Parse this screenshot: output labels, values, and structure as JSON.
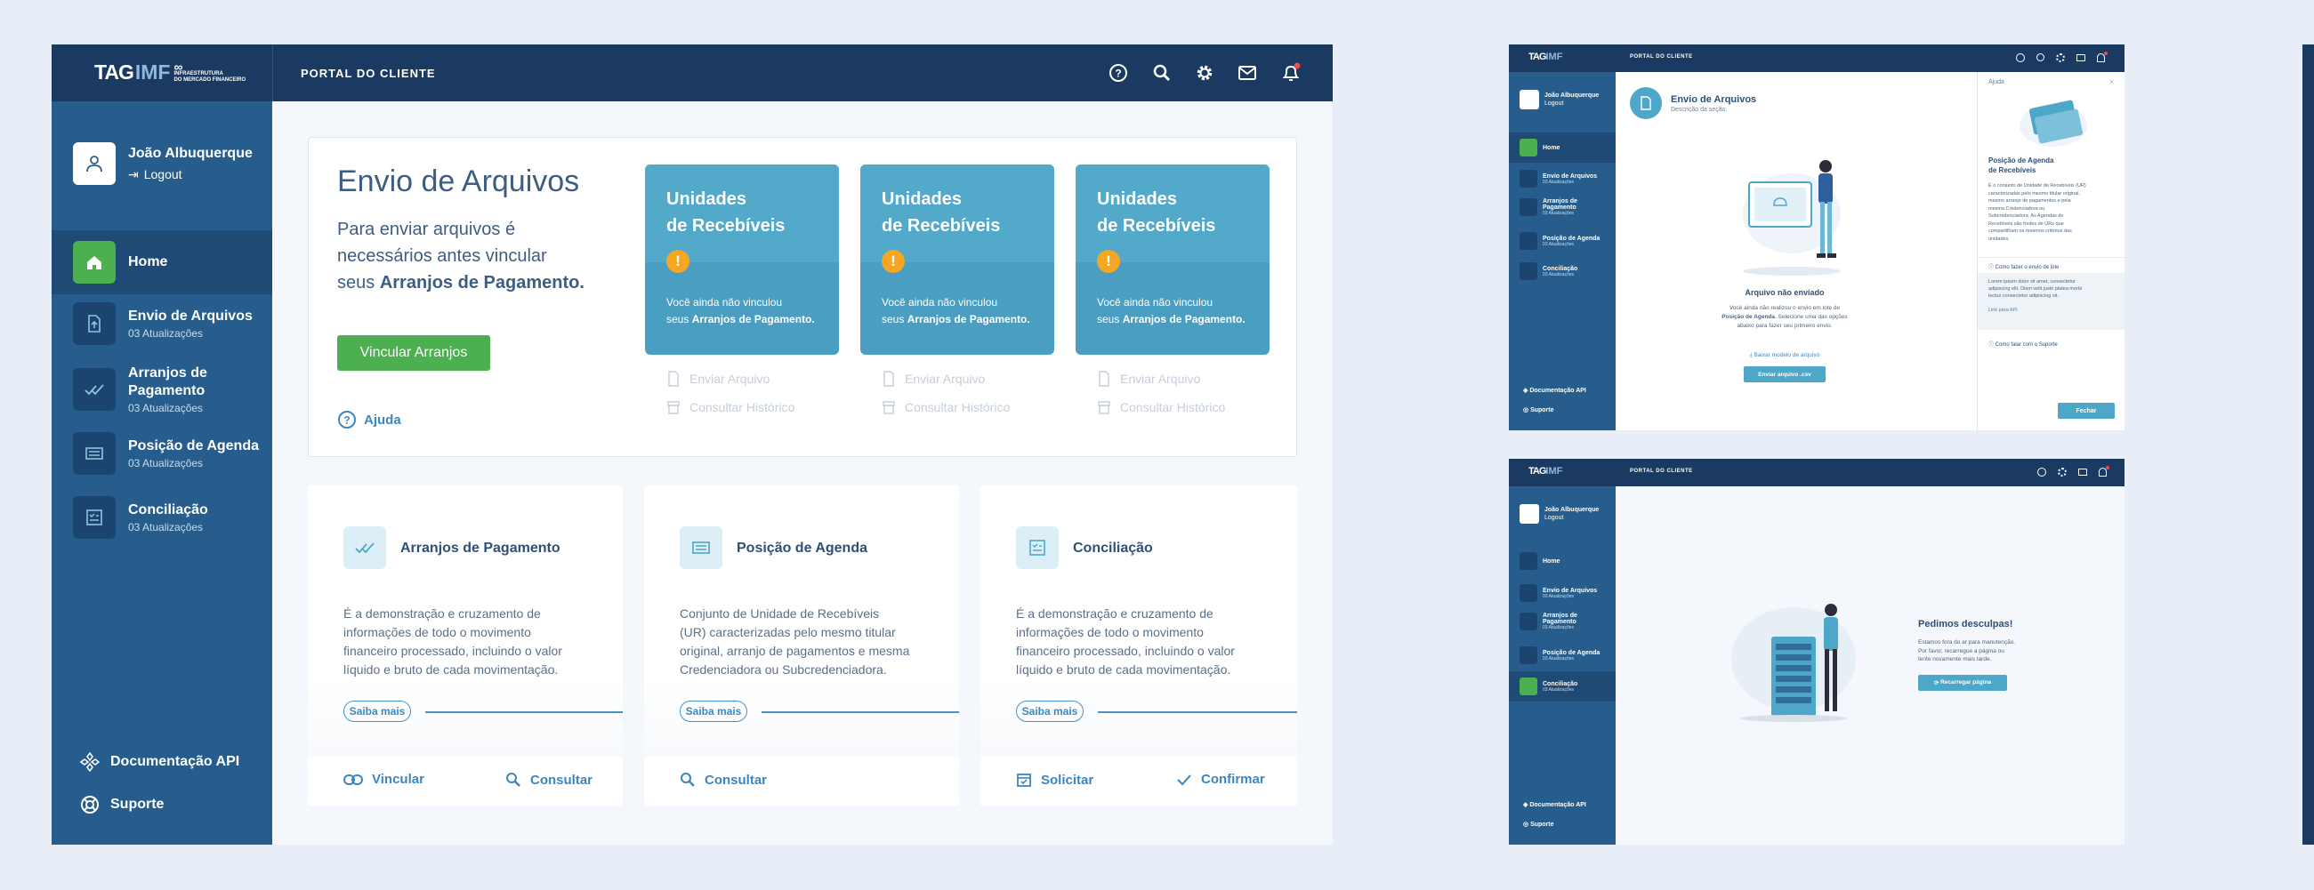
{
  "topbar": {
    "logo_tag": "TAG",
    "logo_imf": "IMF",
    "logo_sub1": "INFRAESTRUTURA",
    "logo_sub2": "DO MERCADO FINANCEIRO",
    "portal_title": "PORTAL DO CLIENTE"
  },
  "user": {
    "name": "João Albuquerque",
    "logout": "Logout"
  },
  "sidebar": {
    "items": [
      {
        "label": "Home",
        "sub": "",
        "icon": "home-icon"
      },
      {
        "label": "Envio de Arquivos",
        "sub": "03 Atualizações",
        "icon": "file-upload-icon"
      },
      {
        "label": "Arranjos de Pagamento",
        "sub": "03 Atualizações",
        "icon": "double-check-icon"
      },
      {
        "label": "Posição de Agenda",
        "sub": "03 Atualizações",
        "icon": "agenda-icon"
      },
      {
        "label": "Conciliação",
        "sub": "03 Atualizações",
        "icon": "checklist-icon"
      }
    ],
    "docs": "Documentação API",
    "support": "Suporte"
  },
  "main": {
    "hero": {
      "title": "Envio de Arquivos",
      "desc1": "Para enviar arquivos é",
      "desc2": "necessários antes vincular",
      "desc3": "seus ",
      "desc3_bold": "Arranjos de Pagamento.",
      "button": "Vincular Arranjos",
      "help": "Ajuda"
    },
    "receivable_cards": [
      {
        "title1": "Unidades",
        "title2": "de Recebíveis",
        "msg1": "Você ainda não vinculou",
        "msg2a": "seus ",
        "msg2b": "Arranjos de Pagamento.",
        "action1": "Enviar Arquivo",
        "action2": "Consultar Histórico"
      },
      {
        "title1": "Unidades",
        "title2": "de Recebíveis",
        "msg1": "Você ainda não vinculou",
        "msg2a": "seus ",
        "msg2b": "Arranjos de Pagamento.",
        "action1": "Enviar Arquivo",
        "action2": "Consultar Histórico"
      },
      {
        "title1": "Unidades",
        "title2": "de Recebíveis",
        "msg1": "Você ainda não vinculou",
        "msg2a": "seus ",
        "msg2b": "Arranjos de Pagamento.",
        "action1": "Enviar Arquivo",
        "action2": "Consultar Histórico"
      }
    ],
    "info_cards": [
      {
        "title": "Arranjos de Pagamento",
        "icon": "double-check-icon",
        "lines": [
          "É a demonstração e cruzamento de",
          "informações de todo o movimento",
          "financeiro processado, incluindo o valor",
          "líquido e bruto de cada movimentação."
        ],
        "more": "Saiba mais",
        "actions": [
          "Vincular",
          "Consultar"
        ]
      },
      {
        "title": "Posição de Agenda",
        "icon": "agenda-icon",
        "lines": [
          "Conjunto de Unidade de Recebíveis",
          "(UR) caracterizadas pelo mesmo titular",
          "original, arranjo de pagamentos e mesma",
          "Credenciadora ou Subcredenciadora."
        ],
        "more": "Saiba mais",
        "actions": [
          "Consultar"
        ]
      },
      {
        "title": "Conciliação",
        "icon": "checklist-icon",
        "lines": [
          "É a demonstração e cruzamento de",
          "informações de todo o movimento",
          "financeiro processado, incluindo o valor",
          "líquido e bruto de cada movimentação."
        ],
        "more": "Saiba mais",
        "actions": [
          "Solicitar",
          "Confirmar"
        ]
      }
    ]
  },
  "screen2": {
    "section_title": "Envio de Arquivos",
    "section_desc": "Descrição da seção.",
    "empty_title": "Arquivo não enviado",
    "empty_l1": "Você ainda não realizou o envio em lote de",
    "empty_l2a": "Posição de Agenda",
    "empty_l2b": ". Selecione uma das opções",
    "empty_l3": "abaixo para fazer seu primeiro envio.",
    "download_link": "Baixar modelo de arquivo",
    "send_button": "Enviar arquivo .csv",
    "help_panel": {
      "title": "Ajuda",
      "heading1": "Posição de Agenda",
      "heading2": "de Recebíveis",
      "body": [
        "É o conjunto de Unidade de Recebíveis (UR)",
        "caracterizadas pelo mesmo titular original,",
        "mesmo arranjo de pagamentos e pela",
        "mesma Credenciadora ou",
        "Subcredenciadora. As Agendas de",
        "Recebíveis são fontes de URs que",
        "compartilham os mesmos critérios das",
        "unidades."
      ],
      "faq1": "Como fazer o envio de lote",
      "faq1_body": [
        "Lorem ipsum dolor sit amet, consectetur",
        "adipiscing elit. Diam velit justo platea morbi",
        "lectus consectetur adipiscing sit."
      ],
      "faq1_link": "Link para API",
      "faq2": "Como falar com o Suporte",
      "close": "Fechar"
    }
  },
  "screen3": {
    "title": "Pedimos desculpas!",
    "l1": "Estamos fora do ar para manutenção.",
    "l2": "Por favor, recarregue a página ou",
    "l3": "tente novamente mais tarde.",
    "button": "Recarregar página"
  },
  "colors": {
    "navy": "#1a3a61",
    "sidebar": "#265d8c",
    "accent": "#4da7c8",
    "green": "#4caf50"
  }
}
